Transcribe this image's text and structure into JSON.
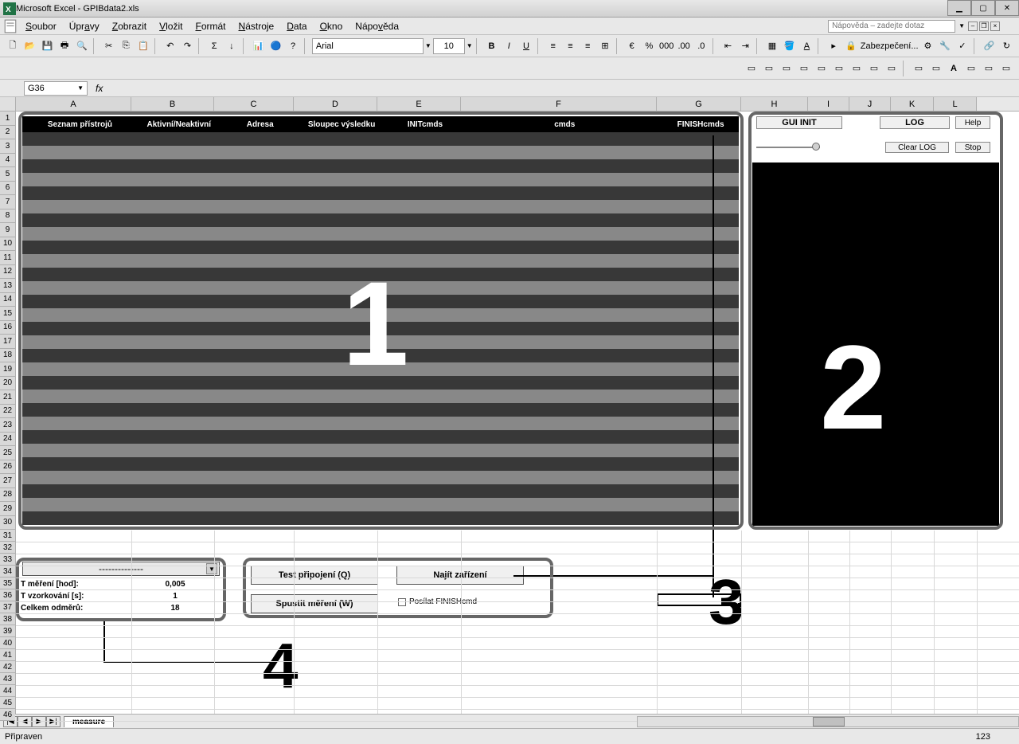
{
  "window": {
    "title": "Microsoft Excel - GPIBdata2.xls",
    "buttons": {
      "min": "▁",
      "max": "▢",
      "close": "✕"
    }
  },
  "menu": {
    "items": [
      "Soubor",
      "Úpravy",
      "Zobrazit",
      "Vložit",
      "Formát",
      "Nástroje",
      "Data",
      "Okno",
      "Nápověda"
    ],
    "helpPlaceholder": "Nápověda – zadejte dotaz"
  },
  "toolbar": {
    "font": "Arial",
    "size": "10",
    "security": "Zabezpečení..."
  },
  "formula": {
    "nameBox": "G36",
    "fx": "fx"
  },
  "columns": [
    "A",
    "B",
    "C",
    "D",
    "E",
    "F",
    "G",
    "H",
    "I",
    "J",
    "K",
    "L"
  ],
  "blackHeader": [
    "Seznam přístrojů",
    "Aktivní/Neaktivní",
    "Adresa",
    "Sloupec výsledku",
    "INITcmds",
    "cmds",
    "FINISHcmds"
  ],
  "bigNumbers": {
    "n1": "1",
    "n2": "2",
    "n3": "3",
    "n4": "4"
  },
  "region2": {
    "guiinit": "GUI INIT",
    "log": "LOG",
    "help": "Help",
    "clearlog": "Clear LOG",
    "stop": "Stop"
  },
  "region3": {
    "test": "Test připojení (Q)",
    "najit": "Najít zařízení",
    "spustit": "Spustit měření (W)",
    "checkbox": "Posílat FINISHcmd"
  },
  "region4": {
    "dropdown": "--------------",
    "rows": [
      {
        "label": "T měření [hod]:",
        "value": "0,005"
      },
      {
        "label": "T vzorkování [s]:",
        "value": "1"
      },
      {
        "label": "Celkem odměrů:",
        "value": "18"
      }
    ]
  },
  "sheet": {
    "tab": "measure",
    "nav": [
      "|◀",
      "◀",
      "▶",
      "▶|"
    ]
  },
  "status": {
    "ready": "Připraven",
    "right": "123"
  }
}
